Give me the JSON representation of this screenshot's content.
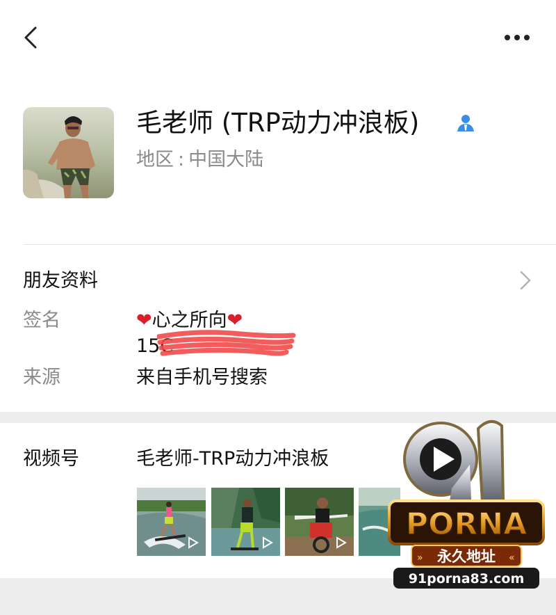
{
  "header": {
    "nickname": "毛老师 (TRP动力冲浪板)",
    "region_label": "地区",
    "region_value": "中国大陆"
  },
  "friend_info": {
    "title": "朋友资料",
    "signature_label": "签名",
    "signature_text": "心之所向",
    "signature_heart_icon": "heart-icon",
    "signature_line2": "15C",
    "source_label": "来源",
    "source_value": "来自手机号搜索"
  },
  "channels": {
    "label": "视频号",
    "name": "毛老师-TRP动力冲浪板",
    "thumbnails": [
      "video-thumb-1",
      "video-thumb-2",
      "video-thumb-3",
      "video-thumb-4"
    ]
  },
  "watermark": {
    "number": "91",
    "brand": "PORNA",
    "tagline": "永久地址",
    "url": "91porna83.com"
  },
  "colors": {
    "accent_blue": "#3a8ee6",
    "divider": "#e5e5e5",
    "secondary_text": "#8a8a8a",
    "band": "#ededed",
    "heart": "#d6202c",
    "redaction": "#f04a4a"
  }
}
